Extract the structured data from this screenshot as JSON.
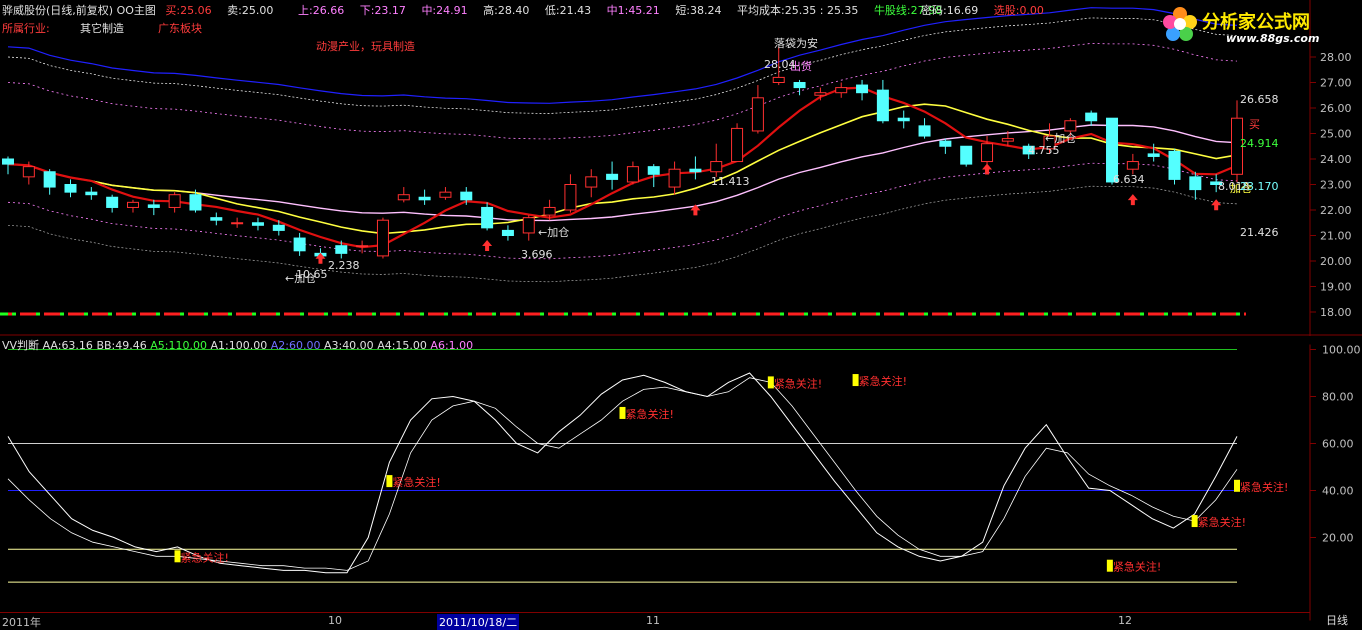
{
  "header": {
    "stock_title": "骅威股份(日线,前复权) OO主图",
    "buy_label": "买:",
    "buy_value": "25.06",
    "sell_label": "卖:",
    "sell_value": "25.00",
    "up_label": "上:",
    "up_value": "26.66",
    "down_label": "下:",
    "down_value": "23.17",
    "mid_label": "中:",
    "mid_value": "24.91",
    "high_label": "高:",
    "high_value": "28.40",
    "low_label": "低:",
    "low_value": "21.43",
    "zhong1_label": "中1:",
    "zhong1_value": "45.21",
    "short_label": "短:",
    "short_value": "38.24",
    "avgcost_label": "平均成本:",
    "avgcost_value": "25.35 : 25.35",
    "bull_label": "牛股线:",
    "bull_value": "27.98",
    "pwd_label": "密码:",
    "pwd_value": "16.69",
    "pick_label": "选股:",
    "pick_value": "0.00"
  },
  "industry": {
    "label": "所属行业:",
    "value": "其它制造",
    "region": "广东板块",
    "concept": "动漫产业，玩具制造"
  },
  "logo": {
    "text": "分析家公式网",
    "url": "www.88gs.com"
  },
  "main_annotations": {
    "luodai": "落袋为安",
    "chuhuo": "出货",
    "buy": "买",
    "jiacang": "←加仓",
    "jiacang2": "加仓"
  },
  "price_labels": [
    "10.65",
    "2.238",
    "3.696",
    "11.413",
    "28.04",
    "4.755",
    "6.634",
    "8.018",
    "26.658",
    "24.914",
    "23.170",
    "21.426"
  ],
  "price_axis": [
    "28.00",
    "27.00",
    "26.00",
    "25.00",
    "24.00",
    "23.00",
    "22.00",
    "21.00",
    "20.00",
    "19.00",
    "18.00"
  ],
  "osc": {
    "title": "VV判断",
    "aa_label": "AA:",
    "aa_value": "63.16",
    "bb_label": "BB:",
    "bb_value": "49.46",
    "a5_label": "A5:",
    "a5_value": "110.00",
    "a1_label": "A1:",
    "a1_value": "100.00",
    "a2_label": "A2:",
    "a2_value": "60.00",
    "a3_label": "A3:",
    "a3_value": "40.00",
    "a4_label": "A4:",
    "a4_value": "15.00",
    "a6_label": "A6:",
    "a6_value": "1.00",
    "alert": "紧急关注!",
    "axis": [
      "100.00",
      "80.00",
      "60.00",
      "40.00",
      "20.00"
    ]
  },
  "time_axis": {
    "labels": [
      "2011年",
      "10",
      "2011/10/18/二",
      "11",
      "12"
    ],
    "cycle": "日线"
  },
  "colors": {
    "up": "#ff3030",
    "down": "#54ffff",
    "ma_red": "#e01010",
    "ma_yellow": "#ffff40",
    "ma_pink": "#ffc0ff",
    "band_blue": "#2020ff",
    "band_pink": "#ff80ff",
    "support": "#ff2020",
    "resistance": "#20ff20"
  },
  "chart_data": [
    {
      "type": "candlestick",
      "title": "骅威股份(日线,前复权) OO主图",
      "ylim": [
        17.6,
        28.6
      ],
      "candles": [
        [
          24.0,
          23.8,
          24.1,
          23.4
        ],
        [
          23.3,
          23.7,
          23.9,
          23.0
        ],
        [
          23.5,
          22.9,
          23.6,
          22.6
        ],
        [
          23.0,
          22.7,
          23.2,
          22.5
        ],
        [
          22.7,
          22.6,
          22.9,
          22.4
        ],
        [
          22.5,
          22.1,
          22.6,
          21.9
        ],
        [
          22.1,
          22.3,
          22.4,
          21.9
        ],
        [
          22.2,
          22.1,
          22.4,
          21.8
        ],
        [
          22.1,
          22.6,
          22.7,
          21.9
        ],
        [
          22.6,
          22.0,
          22.8,
          21.9
        ],
        [
          21.7,
          21.6,
          21.9,
          21.4
        ],
        [
          21.5,
          21.5,
          21.7,
          21.3
        ],
        [
          21.5,
          21.4,
          21.7,
          21.2
        ],
        [
          21.4,
          21.2,
          21.6,
          21.0
        ],
        [
          20.9,
          20.4,
          21.1,
          20.2
        ],
        [
          20.3,
          20.2,
          20.5,
          19.9
        ],
        [
          20.6,
          20.3,
          20.8,
          20.1
        ],
        [
          20.6,
          20.6,
          20.8,
          20.3
        ],
        [
          20.2,
          21.6,
          21.7,
          20.1
        ],
        [
          22.4,
          22.6,
          22.9,
          22.3
        ],
        [
          22.5,
          22.4,
          22.8,
          22.2
        ],
        [
          22.5,
          22.7,
          22.9,
          22.4
        ],
        [
          22.7,
          22.4,
          22.9,
          22.2
        ],
        [
          22.1,
          21.3,
          22.3,
          21.2
        ],
        [
          21.2,
          21.0,
          21.4,
          20.8
        ],
        [
          21.1,
          21.7,
          21.8,
          20.8
        ],
        [
          21.8,
          22.1,
          22.4,
          21.6
        ],
        [
          22.0,
          23.0,
          23.4,
          21.9
        ],
        [
          22.9,
          23.3,
          23.6,
          22.5
        ],
        [
          23.4,
          23.2,
          23.9,
          22.8
        ],
        [
          23.1,
          23.7,
          23.9,
          23.0
        ],
        [
          23.7,
          23.4,
          23.8,
          22.9
        ],
        [
          22.9,
          23.6,
          23.9,
          22.6
        ],
        [
          23.6,
          23.5,
          24.1,
          23.2
        ],
        [
          23.5,
          23.9,
          24.6,
          23.3
        ],
        [
          23.9,
          25.2,
          25.4,
          23.9
        ],
        [
          25.1,
          26.4,
          26.9,
          25.0
        ],
        [
          27.0,
          27.2,
          28.4,
          26.9
        ],
        [
          27.0,
          26.8,
          27.1,
          26.5
        ],
        [
          26.5,
          26.6,
          26.8,
          26.3
        ],
        [
          26.6,
          26.8,
          27.0,
          26.4
        ],
        [
          26.9,
          26.6,
          27.1,
          26.3
        ],
        [
          26.7,
          25.5,
          27.1,
          25.4
        ],
        [
          25.6,
          25.5,
          25.9,
          25.2
        ],
        [
          25.3,
          24.9,
          25.6,
          24.8
        ],
        [
          24.7,
          24.5,
          24.8,
          24.2
        ],
        [
          24.5,
          23.8,
          24.5,
          23.7
        ],
        [
          23.9,
          24.6,
          24.9,
          23.8
        ],
        [
          24.7,
          24.8,
          25.1,
          24.5
        ],
        [
          24.5,
          24.2,
          24.6,
          24.0
        ],
        [
          24.4,
          24.9,
          25.4,
          24.2
        ],
        [
          25.1,
          25.5,
          25.6,
          24.9
        ],
        [
          25.8,
          25.5,
          25.9,
          25.3
        ],
        [
          25.6,
          23.1,
          25.6,
          23.0
        ],
        [
          23.6,
          23.9,
          24.2,
          23.4
        ],
        [
          24.2,
          24.1,
          24.6,
          23.9
        ],
        [
          24.3,
          23.2,
          24.4,
          23.0
        ],
        [
          23.3,
          22.8,
          23.5,
          22.4
        ],
        [
          23.1,
          23.0,
          23.4,
          22.7
        ],
        [
          23.4,
          25.6,
          26.3,
          23.1
        ]
      ]
    },
    {
      "type": "line",
      "title": "VV判断",
      "ylim": [
        0,
        115
      ],
      "series": [
        {
          "name": "AA",
          "values": [
            63,
            48,
            38,
            28,
            23,
            20,
            16,
            14,
            16,
            12,
            9,
            8,
            7,
            6,
            6,
            5,
            5,
            20,
            52,
            70,
            79,
            80,
            78,
            70,
            60,
            56,
            65,
            72,
            81,
            87,
            89,
            86,
            82,
            80,
            86,
            90,
            80,
            68,
            56,
            44,
            33,
            22,
            16,
            12,
            10,
            12,
            18,
            42,
            58,
            68,
            54,
            41,
            40,
            34,
            28,
            24,
            30,
            46,
            63
          ]
        },
        {
          "name": "BB",
          "values": [
            45,
            36,
            28,
            22,
            18,
            16,
            14,
            12,
            12,
            11,
            10,
            9,
            8,
            8,
            7,
            7,
            6,
            10,
            30,
            56,
            70,
            76,
            78,
            75,
            67,
            60,
            58,
            64,
            70,
            78,
            83,
            84,
            82,
            80,
            82,
            88,
            86,
            76,
            64,
            52,
            40,
            29,
            21,
            15,
            12,
            12,
            14,
            28,
            46,
            58,
            56,
            47,
            42,
            38,
            33,
            29,
            27,
            36,
            49
          ]
        }
      ],
      "reference_lines": {
        "A1": 100,
        "A2": 60,
        "A3": 40,
        "A4": 15,
        "A5": 110,
        "A6": 1
      }
    }
  ]
}
